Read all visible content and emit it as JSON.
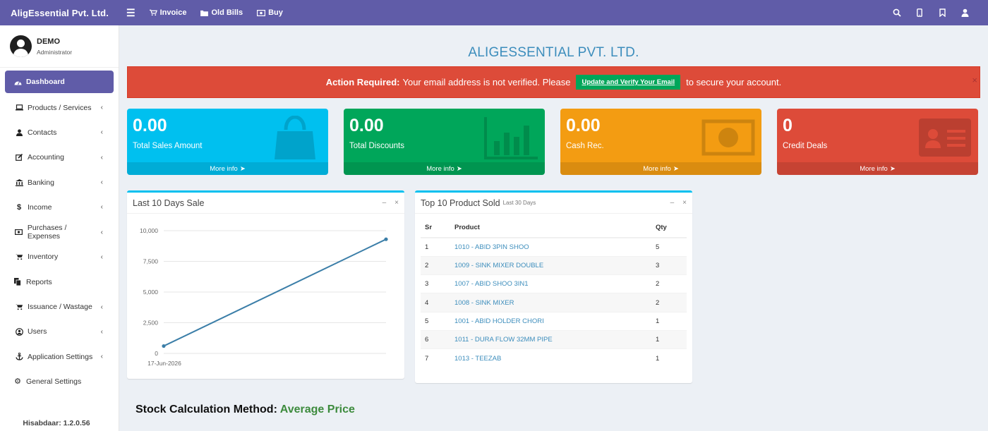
{
  "app": {
    "brand": "AligEssential Pvt. Ltd.",
    "nav_left": [
      {
        "label": "Invoice",
        "icon": "cart-icon"
      },
      {
        "label": "Old Bills",
        "icon": "folder-icon"
      },
      {
        "label": "Buy",
        "icon": "money-icon"
      }
    ],
    "nav_right_icons": [
      "search-icon",
      "mobile-icon",
      "bookmark-icon",
      "user-icon"
    ]
  },
  "user": {
    "name": "DEMO",
    "role": "Administrator"
  },
  "sidebar": {
    "items": [
      {
        "label": "Dashboard",
        "icon": "dashboard-icon",
        "active": true,
        "has_children": false
      },
      {
        "label": "Products / Services",
        "icon": "laptop-icon",
        "has_children": true
      },
      {
        "label": "Contacts",
        "icon": "user-icon",
        "has_children": true
      },
      {
        "label": "Accounting",
        "icon": "edit-icon",
        "has_children": true
      },
      {
        "label": "Banking",
        "icon": "bank-icon",
        "has_children": true
      },
      {
        "label": "Income",
        "icon": "dollar-icon",
        "has_children": true
      },
      {
        "label": "Purchases / Expenses",
        "icon": "money-icon",
        "has_children": true
      },
      {
        "label": "Inventory",
        "icon": "cart-icon",
        "has_children": true
      },
      {
        "label": "Reports",
        "icon": "copy-icon",
        "has_children": false
      },
      {
        "label": "Issuance / Wastage",
        "icon": "cart-icon",
        "has_children": true
      },
      {
        "label": "Users",
        "icon": "user-circle-icon",
        "has_children": true
      },
      {
        "label": "Application Settings",
        "icon": "anchor-icon",
        "has_children": true
      },
      {
        "label": "General Settings",
        "icon": "gear-icon",
        "has_children": false
      }
    ],
    "version": "Hisabdaar: 1.2.0.56"
  },
  "main": {
    "company_title": "ALIGESSENTIAL PVT. LTD.",
    "alert": {
      "prefix": "Action Required:",
      "text_before": "Your email address is not verified. Please",
      "button": "Update and Verify Your Email",
      "text_after": "to secure your account.",
      "close": "×"
    },
    "stat_boxes": [
      {
        "value": "0.00",
        "label": "Total Sales Amount",
        "more": "More info",
        "color": "#00c0ef",
        "icon": "shopping-bag-icon"
      },
      {
        "value": "0.00",
        "label": "Total Discounts",
        "more": "More info",
        "color": "#00a65a",
        "icon": "bar-chart-icon"
      },
      {
        "value": "0.00",
        "label": "Cash Rec.",
        "more": "More info",
        "color": "#f39c12",
        "icon": "banknote-icon"
      },
      {
        "value": "0",
        "label": "Credit Deals",
        "more": "More info",
        "color": "#dd4b39",
        "icon": "id-card-icon"
      }
    ],
    "sales_chart": {
      "title": "Last 10 Days Sale",
      "minimize": "–",
      "close": "×"
    },
    "top_products": {
      "title": "Top 10 Product Sold",
      "subtitle": "Last 30 Days",
      "minimize": "–",
      "close": "×",
      "columns": [
        "Sr",
        "Product",
        "Qty"
      ],
      "rows": [
        {
          "sr": "1",
          "product": "1010 - ABID 3PIN SHOO",
          "qty": "5"
        },
        {
          "sr": "2",
          "product": "1009 - SINK MIXER DOUBLE",
          "qty": "3"
        },
        {
          "sr": "3",
          "product": "1007 - ABID SHOO 3IN1",
          "qty": "2"
        },
        {
          "sr": "4",
          "product": "1008 - SINK MIXER",
          "qty": "2"
        },
        {
          "sr": "5",
          "product": "1001 - ABID HOLDER CHORI",
          "qty": "1"
        },
        {
          "sr": "6",
          "product": "1011 - DURA FLOW 32MM PIPE",
          "qty": "1"
        },
        {
          "sr": "7",
          "product": "1013 - TEEZAB",
          "qty": "1"
        }
      ]
    },
    "stock_method": {
      "label": "Stock Calculation Method:",
      "value": "Average Price"
    }
  },
  "chart_data": {
    "type": "line",
    "title": "",
    "x": [
      "17-Jun-2026",
      ""
    ],
    "x_tick_labels": [
      "17-Jun-2026"
    ],
    "series": [
      {
        "values": [
          600,
          9300
        ],
        "color": "#3b7ea8"
      }
    ],
    "ylim": [
      0,
      10000
    ],
    "yticks": [
      "0",
      "2,500",
      "5,000",
      "7,500",
      "10,000"
    ],
    "ytick_values": [
      0,
      2500,
      5000,
      7500,
      10000
    ],
    "grid": true,
    "legend": "none"
  }
}
